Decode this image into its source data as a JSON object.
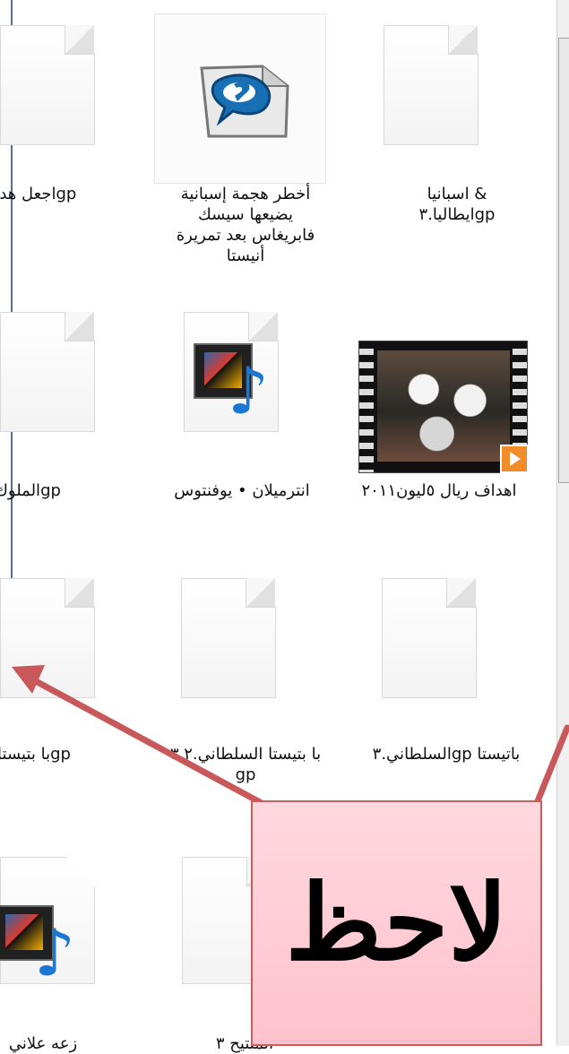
{
  "files": [
    {
      "label": "& اسبانيا\ngpايطاليا.٣",
      "type": "doc"
    },
    {
      "label": "أخطر هجمة إسبانية يضيعها سيسك فابريغاس بعد تمريرة أنيستا",
      "type": "real-player"
    },
    {
      "label": "gpاجعل هدف",
      "type": "doc"
    },
    {
      "label": "اهداف ريال ٥ليون٢٠١١",
      "type": "video-thumbnail"
    },
    {
      "label": "انترميلان • يوفنتوس",
      "type": "media"
    },
    {
      "label": "gpالملوك",
      "type": "doc"
    },
    {
      "label": "باتيستا gpالسلطاني.٣",
      "type": "doc"
    },
    {
      "label": "با بتيستا السلطاني.٣.٢ gp",
      "type": "doc"
    },
    {
      "label": "gpبا بتيستا",
      "type": "doc"
    },
    {
      "label": "المنتيح ٣",
      "type": "doc"
    },
    {
      "label": "زعه علاني",
      "type": "media"
    }
  ],
  "callout": {
    "text": "لاحظ"
  },
  "colors": {
    "arrow": "#c9585a",
    "callout_fill": "#ffc2cc",
    "callout_border": "#c5605e"
  }
}
